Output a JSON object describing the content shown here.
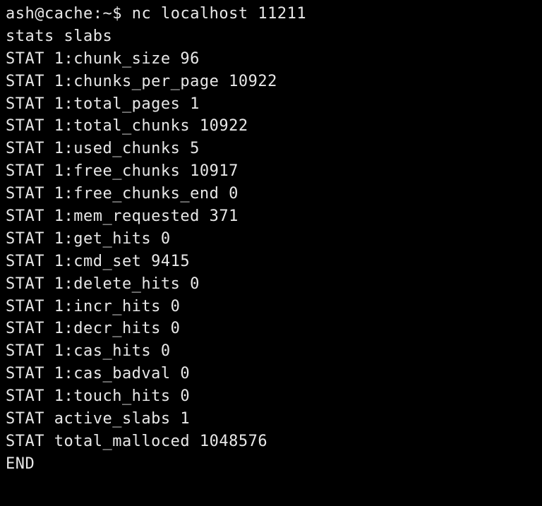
{
  "prompt": {
    "user_host": "ash@cache",
    "path": "~",
    "symbol": "$",
    "command": "nc localhost 11211"
  },
  "input_command": "stats slabs",
  "stats": [
    {
      "label": "STAT 1:chunk_size",
      "value": "96"
    },
    {
      "label": "STAT 1:chunks_per_page",
      "value": "10922"
    },
    {
      "label": "STAT 1:total_pages",
      "value": "1"
    },
    {
      "label": "STAT 1:total_chunks",
      "value": "10922"
    },
    {
      "label": "STAT 1:used_chunks",
      "value": "5"
    },
    {
      "label": "STAT 1:free_chunks",
      "value": "10917"
    },
    {
      "label": "STAT 1:free_chunks_end",
      "value": "0"
    },
    {
      "label": "STAT 1:mem_requested",
      "value": "371"
    },
    {
      "label": "STAT 1:get_hits",
      "value": "0"
    },
    {
      "label": "STAT 1:cmd_set",
      "value": "9415"
    },
    {
      "label": "STAT 1:delete_hits",
      "value": "0"
    },
    {
      "label": "STAT 1:incr_hits",
      "value": "0"
    },
    {
      "label": "STAT 1:decr_hits",
      "value": "0"
    },
    {
      "label": "STAT 1:cas_hits",
      "value": "0"
    },
    {
      "label": "STAT 1:cas_badval",
      "value": "0"
    },
    {
      "label": "STAT 1:touch_hits",
      "value": "0"
    },
    {
      "label": "STAT active_slabs",
      "value": "1"
    },
    {
      "label": "STAT total_malloced",
      "value": "1048576"
    }
  ],
  "end_marker": "END"
}
